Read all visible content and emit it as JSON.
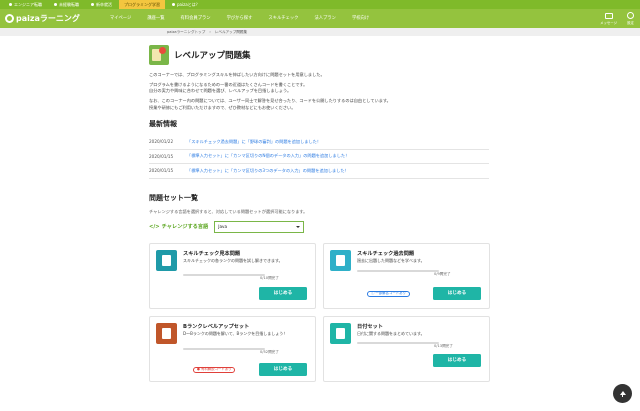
{
  "topbar": {
    "items": [
      {
        "label": "エンジニア転職",
        "active": false
      },
      {
        "label": "未経験転職",
        "active": false
      },
      {
        "label": "新卒就活",
        "active": false
      },
      {
        "label": "プログラミング学習",
        "active": true
      },
      {
        "label": "paizaとは？",
        "active": false
      }
    ]
  },
  "header": {
    "logo": "paizaラーニング",
    "nav": [
      "マイページ",
      "講座一覧",
      "有料会員プラン",
      "学びから探す",
      "スキルチェック",
      "法人プラン",
      "学校向け"
    ],
    "messages_label": "メッセージ",
    "settings_label": "設定"
  },
  "breadcrumb": {
    "items": [
      "paizaラーニングトップ",
      "レベルアップ問題集"
    ],
    "separator": "›"
  },
  "page": {
    "title": "レベルアップ問題集",
    "intro": [
      "このコーナーでは、プログラミングスキルを伸ばしたい方向けに問題セットを用意しました。",
      "プログラムを書けるようになるための一番の近道はたくさんコードを書くことです。",
      "自分の実力や興味に合わせて問題を選び、レベルアップを目指しましょう。",
      "なお、このコーナー内の問題については、ユーザー同士で解答を見せ合ったり、コードを公開したりするのは自由としています。",
      "授業や研修にもご利用いただけますので、ぜひ教材などにもお使いください。"
    ]
  },
  "news": {
    "title": "最新情報",
    "items": [
      {
        "date": "2020/01/22",
        "text": "「スキルチェック過去問題」に「野球の審判」の問題を追加しました！"
      },
      {
        "date": "2020/01/15",
        "text": "「標準入力セット」に「カンマ区切りのN個のデータの入力」の問題を追加しました！"
      },
      {
        "date": "2020/01/15",
        "text": "「標準入力セット」に「カンマ区切りの3つのデータの入力」の問題を追加しました！"
      }
    ]
  },
  "sets": {
    "title": "問題セット一覧",
    "hint": "チャレンジする言語を選択すると、対応している問題セットが選択可能になります。",
    "lang_label": "チャレンジする言語",
    "lang_value": "Java",
    "start_label": "はじめる",
    "cards": [
      {
        "title": "スキルチェック見本問題",
        "desc": "スキルチェックの各ランクの問題を試し解きできます。",
        "progress_text": "0/10問完了",
        "progress": 0.0,
        "badge": "",
        "color": "#1f9aa8"
      },
      {
        "title": "スキルチェック過去問題",
        "desc": "過去に出題した問題などを学べます。",
        "progress_text": "0/9問完了",
        "progress": 0.0,
        "badge": "一部解答コードあり",
        "badge_color": "#2a7ae2",
        "color": "#2fb0c8"
      },
      {
        "title": "Bランクレベルアップセット",
        "desc": "D〜Bランクの問題を解いて、Bランクを目指しましょう！",
        "progress_text": "0/52問完了",
        "progress": 0.0,
        "badge": "有料解説コードあり",
        "badge_color": "#e0403a",
        "color": "#c0562a"
      },
      {
        "title": "日付セット",
        "desc": "日付に関する問題をまとめています。",
        "progress_text": "0/13問完了",
        "progress": 0.0,
        "badge": "",
        "color": "#1fb5a6"
      }
    ]
  }
}
